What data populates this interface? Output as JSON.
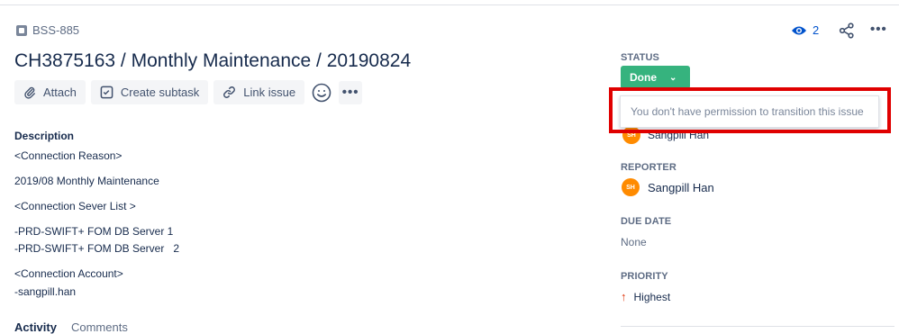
{
  "issue": {
    "key": "BSS-885",
    "title": "CH3875163 / Monthly Maintenance / 20190824"
  },
  "toolbar": {
    "attach": "Attach",
    "create_subtask": "Create subtask",
    "link_issue": "Link issue",
    "more": "•••"
  },
  "description": {
    "heading": "Description",
    "lines": [
      "<Connection Reason>",
      "2019/08 Monthly Maintenance",
      "<Connection Sever List >",
      "-PRD-SWIFT+ FOM DB Server 1",
      "-PRD-SWIFT+ FOM DB Server   2",
      "<Connection Account>",
      "-sangpill.han"
    ]
  },
  "activity": {
    "label": "Activity",
    "filter": "Comments"
  },
  "header_actions": {
    "watchers_count": "2",
    "more": "•••"
  },
  "status": {
    "label": "STATUS",
    "value": "Done",
    "tooltip": "You don't have permission to transition this issue",
    "color": "#36b37e"
  },
  "assignee": {
    "name": "Sangpill Han",
    "initials": "SH"
  },
  "reporter": {
    "label": "REPORTER",
    "name": "Sangpill Han",
    "initials": "SH"
  },
  "due_date": {
    "label": "DUE DATE",
    "value": "None"
  },
  "priority": {
    "label": "PRIORITY",
    "value": "Highest",
    "arrow": "↑"
  },
  "colors": {
    "highlight": "#e00000",
    "avatar": "#ff8b00",
    "link": "#0052cc"
  }
}
